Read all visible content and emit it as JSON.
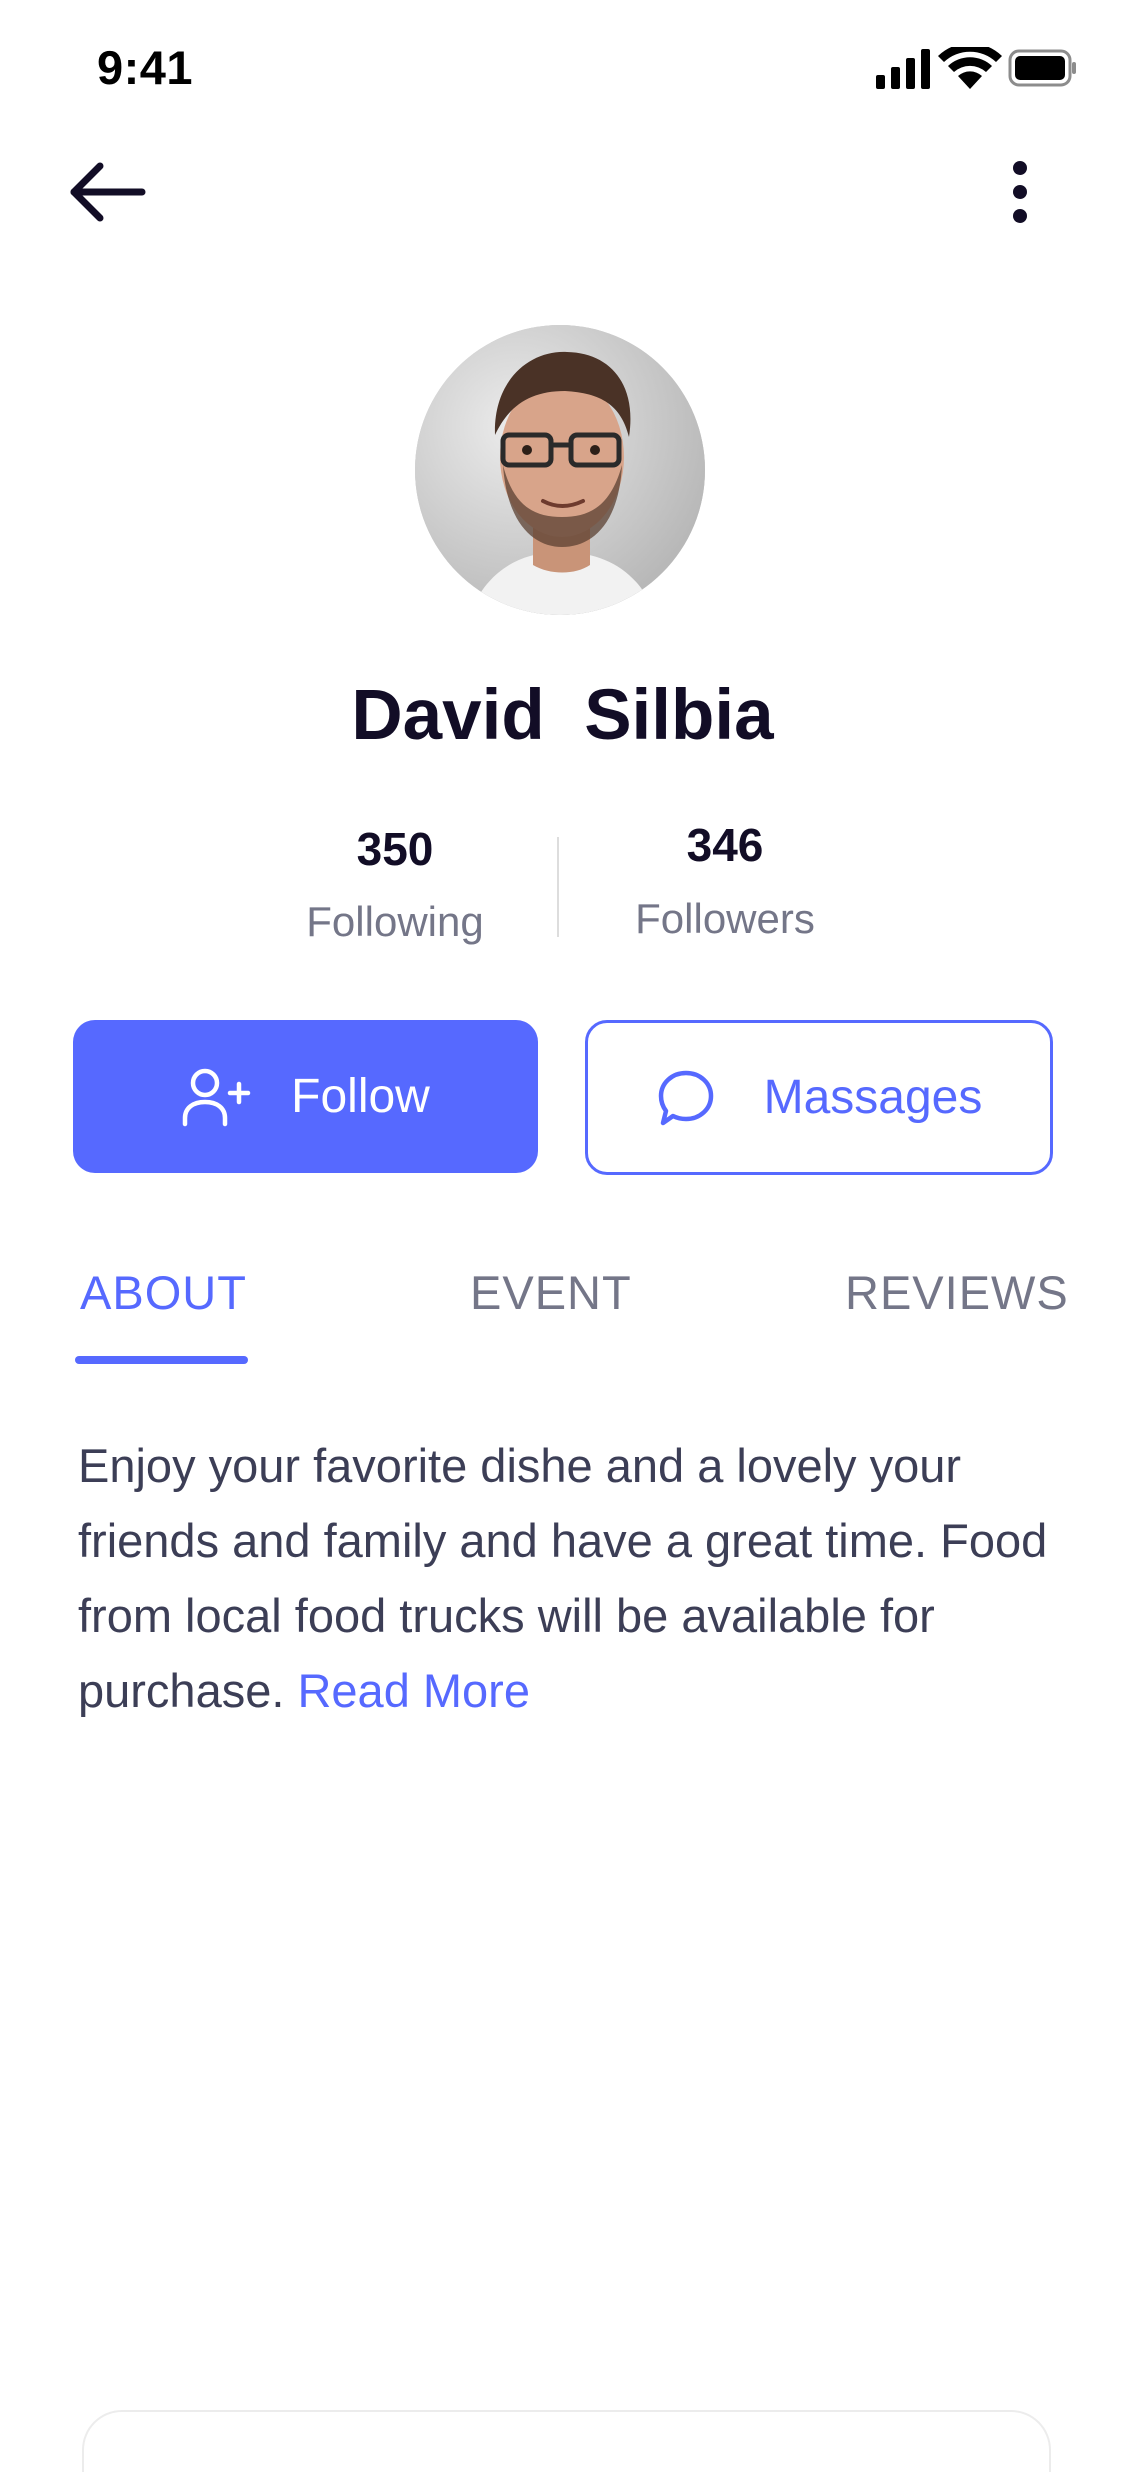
{
  "status_bar": {
    "time": "9:41",
    "icons": [
      "cellular-signal-icon",
      "wifi-icon",
      "battery-icon"
    ]
  },
  "nav": {
    "back_icon": "arrow-left-icon",
    "more_icon": "more-vertical-icon"
  },
  "profile": {
    "name": "David  Silbia",
    "stats": [
      {
        "value": "350",
        "label": "Following"
      },
      {
        "value": "346",
        "label": "Followers"
      }
    ]
  },
  "actions": {
    "follow_label": "Follow",
    "follow_icon": "user-plus-icon",
    "messages_label": "Massages",
    "messages_icon": "chat-bubble-icon"
  },
  "tabs": [
    {
      "label": "ABOUT",
      "active": true
    },
    {
      "label": "EVENT",
      "active": false
    },
    {
      "label": "REVIEWS",
      "active": false
    }
  ],
  "about": {
    "text": "Enjoy your favorite dishe and a lovely your friends and family and have a great time. Food from local food trucks will be available for purchase.",
    "read_more": "Read More"
  },
  "colors": {
    "accent": "#5669ff",
    "title": "#120d26",
    "muted": "#747688",
    "body": "#3c3e56"
  }
}
